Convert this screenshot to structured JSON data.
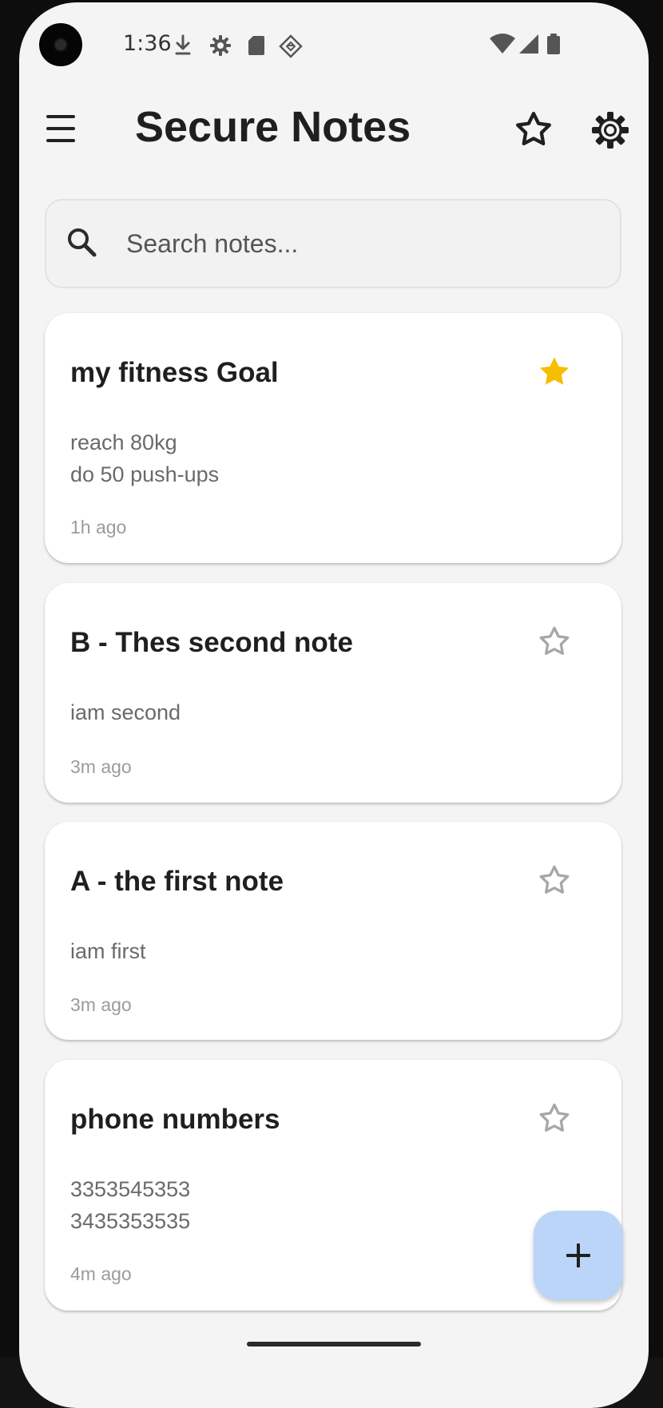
{
  "status_bar": {
    "time": "1:36",
    "left_icons": [
      "download-icon",
      "settings-gear-icon",
      "sd-card-icon",
      "diamond-app-icon"
    ],
    "right_icons": [
      "wifi-icon",
      "cell-signal-icon",
      "battery-icon"
    ]
  },
  "app_bar": {
    "title": "Secure Notes",
    "menu_icon": "hamburger-menu-icon",
    "favorites_icon": "star-outline-icon",
    "settings_icon": "gear-icon"
  },
  "search": {
    "placeholder": "Search notes...",
    "value": ""
  },
  "notes": [
    {
      "title": "my fitness Goal",
      "body_lines": [
        "reach 80kg",
        "do 50 push-ups"
      ],
      "time": "1h ago",
      "starred": true
    },
    {
      "title": "B - Thes second note",
      "body_lines": [
        "iam second"
      ],
      "time": "3m ago",
      "starred": false
    },
    {
      "title": "A - the first note",
      "body_lines": [
        "iam first"
      ],
      "time": "3m ago",
      "starred": false
    },
    {
      "title": "phone numbers",
      "body_lines": [
        "3353545353",
        "3435353535"
      ],
      "time": "4m ago",
      "starred": false
    }
  ],
  "fab": {
    "icon": "plus-icon"
  },
  "colors": {
    "background": "#f4f4f4",
    "card": "#ffffff",
    "starred": "#f6be00",
    "star_outline": "#a7a7a7",
    "fab": "#bad5f7",
    "title_text": "#1f1f1f",
    "body_text": "#6a6a6a",
    "time_text": "#9b9b9b"
  }
}
